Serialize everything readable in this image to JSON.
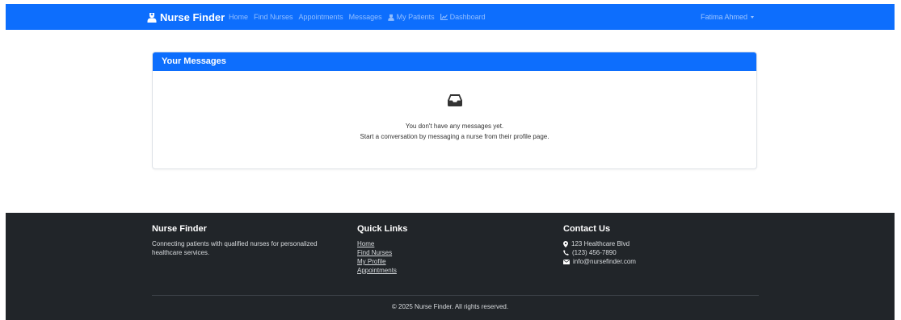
{
  "nav": {
    "brand": "Nurse Finder",
    "links": {
      "home": "Home",
      "find_nurses": "Find Nurses",
      "appointments": "Appointments",
      "messages": "Messages",
      "my_patients": "My Patients",
      "dashboard": "Dashboard"
    },
    "user": "Fatima Ahmed"
  },
  "messages_card": {
    "title": "Your Messages",
    "empty_line1": "You don't have any messages yet.",
    "empty_line2": "Start a conversation by messaging a nurse from their profile page."
  },
  "footer": {
    "about": {
      "heading": "Nurse Finder",
      "text": "Connecting patients with qualified nurses for personalized healthcare services."
    },
    "quick_links": {
      "heading": "Quick Links",
      "items": [
        "Home",
        "Find Nurses",
        "My Profile",
        "Appointments"
      ]
    },
    "contact": {
      "heading": "Contact Us",
      "address": "123 Healthcare Blvd",
      "phone": "(123) 456-7890",
      "email": "info@nursefinder.com"
    },
    "copyright": "© 2025 Nurse Finder. All rights reserved."
  },
  "colors": {
    "primary": "#0d6efd",
    "footer_bg": "#212529",
    "page_bg": "#ffffff"
  }
}
